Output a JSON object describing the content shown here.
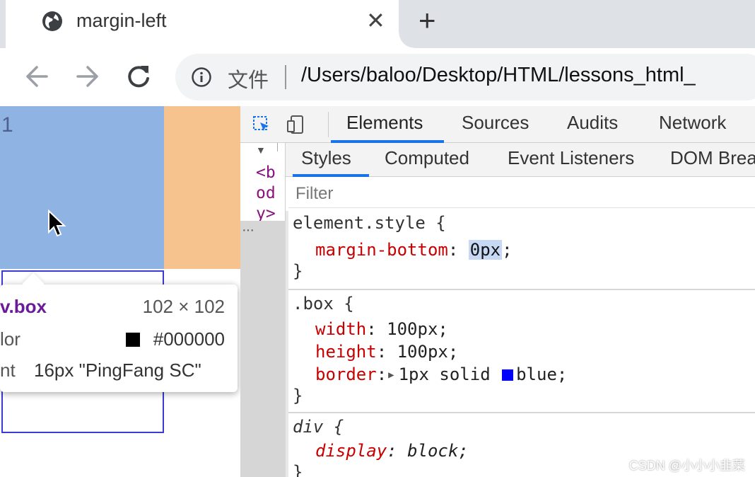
{
  "browser": {
    "tab_title": "margin-left",
    "tab_icon": "globe-icon",
    "origin_label": "文件",
    "url": "/Users/baloo/Desktop/HTML/lessons_html_"
  },
  "page": {
    "box_number": "1",
    "colors": {
      "box1": "#8fb4e3",
      "box_right": "#f6c28e",
      "outline": "#3a3ad6"
    },
    "tooltip": {
      "selector": "v.box",
      "dimensions": "102 × 102",
      "color_key": "lor",
      "color_value": "#000000",
      "font_key": "nt",
      "font_value": "16px \"PingFang SC\""
    }
  },
  "devtools": {
    "main_tabs": [
      "Elements",
      "Sources",
      "Audits",
      "Network"
    ],
    "elements_code": "<body>",
    "side_tabs": [
      "Styles",
      "Computed",
      "Event Listeners",
      "DOM Brea"
    ],
    "filter_placeholder": "Filter",
    "rules": {
      "element_style": {
        "selector": "element.style {",
        "prop": "margin-bottom",
        "value": "0px",
        "close": "}"
      },
      "box": {
        "selector": ".box {",
        "width_prop": "width",
        "width_val": "100px;",
        "height_prop": "height",
        "height_val": "100px;",
        "border_prop": "border",
        "border_val_1": "1px solid ",
        "border_val_2": "blue;",
        "close": "}"
      },
      "div": {
        "selector": "div {",
        "prop": "display",
        "value": "block;",
        "close": "}"
      }
    }
  },
  "watermark": "CSDN @小小小韭菜"
}
